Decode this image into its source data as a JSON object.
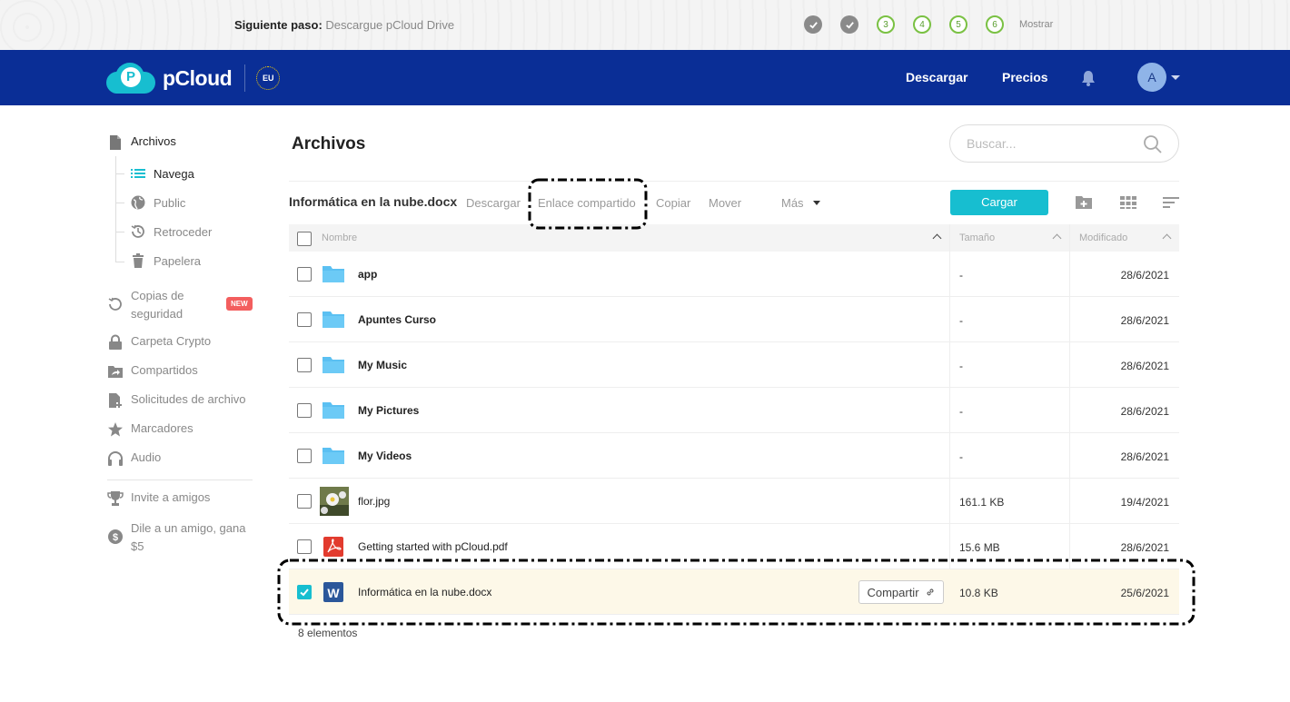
{
  "onboarding": {
    "label": "Siguiente paso:",
    "text": "Descargue pCloud Drive",
    "steps": [
      {
        "status": "done",
        "label": ""
      },
      {
        "status": "done",
        "label": ""
      },
      {
        "status": "todo",
        "label": "3"
      },
      {
        "status": "todo",
        "label": "4"
      },
      {
        "status": "todo",
        "label": "5"
      },
      {
        "status": "todo",
        "label": "6"
      }
    ],
    "show": "Mostrar"
  },
  "header": {
    "brand": "pCloud",
    "region": "EU",
    "download": "Descargar",
    "pricing": "Precios",
    "avatar": "A"
  },
  "sidebar": {
    "files": "Archivos",
    "sub": [
      "Navega",
      "Public",
      "Retroceder",
      "Papelera"
    ],
    "backups": "Copias de seguridad",
    "backups_line1": "Copias de",
    "backups_line2": "seguridad",
    "new_badge": "NEW",
    "crypto": "Carpeta Crypto",
    "shared": "Compartidos",
    "requests": "Solicitudes de archivo",
    "bookmarks": "Marcadores",
    "audio": "Audio",
    "invite": "Invite a amigos",
    "refer_line1": "Dile a un amigo, gana",
    "refer_line2": "$5"
  },
  "main": {
    "title": "Archivos",
    "search_placeholder": "Buscar..."
  },
  "toolbar": {
    "selected": "Informática en la nube.docx",
    "download": "Descargar",
    "share_link": "Enlace compartido",
    "copy": "Copiar",
    "move": "Mover",
    "more": "Más",
    "upload": "Cargar"
  },
  "table": {
    "columns": {
      "name": "Nombre",
      "size": "Tamaño",
      "modified": "Modificado"
    },
    "rows": [
      {
        "name": "app",
        "type": "folder",
        "size": "-",
        "modified": "28/6/2021",
        "checked": false
      },
      {
        "name": "Apuntes Curso",
        "type": "folder",
        "size": "-",
        "modified": "28/6/2021",
        "checked": false
      },
      {
        "name": "My Music",
        "type": "folder",
        "size": "-",
        "modified": "28/6/2021",
        "checked": false
      },
      {
        "name": "My Pictures",
        "type": "folder",
        "size": "-",
        "modified": "28/6/2021",
        "checked": false
      },
      {
        "name": "My Videos",
        "type": "folder",
        "size": "-",
        "modified": "28/6/2021",
        "checked": false
      },
      {
        "name": "flor.jpg",
        "type": "image",
        "size": "161.1 KB",
        "modified": "19/4/2021",
        "checked": false
      },
      {
        "name": "Getting started with pCloud.pdf",
        "type": "pdf",
        "size": "15.6 MB",
        "modified": "28/6/2021",
        "checked": false
      },
      {
        "name": "Informática en la nube.docx",
        "type": "word",
        "size": "10.8 KB",
        "modified": "25/6/2021",
        "checked": true
      }
    ],
    "share_button": "Compartir",
    "count": "8 elementos"
  },
  "colors": {
    "header": "#0a2e96",
    "accent": "#17bed0",
    "folder": "#5bc0f2",
    "selected_row": "#fdf8e8",
    "badge": "#f35e5e"
  }
}
